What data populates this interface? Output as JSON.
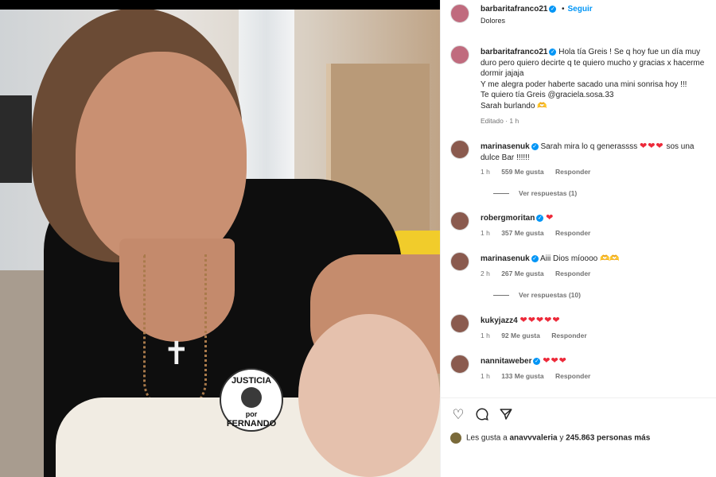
{
  "post_owner": {
    "username": "barbaritafranco21",
    "follow_label": "Seguir",
    "location": "Dolores"
  },
  "photo": {
    "badge_line1": "JUSTICIA",
    "badge_line2": "por",
    "badge_line3": "FERNANDO"
  },
  "caption": {
    "username": "barbaritafranco21",
    "lines": [
      "Hola tía Greis ! Se q hoy fue un día muy",
      "duro pero quiero decirte q te quiero mucho y gracias x hacerme",
      "dormir jajaja",
      "Y me alegra poder haberte sacado una mini sonrisa hoy !!!",
      "Te quiero tía Greis @graciela.sosa.33",
      "Sarah burlando 🫶"
    ],
    "meta": "Editado · 1 h"
  },
  "comments": [
    {
      "username": "marinasenuk",
      "text_a": "Sarah mira lo q generassss",
      "hearts": "❤❤❤",
      "text_b": "sos una",
      "text_line2": "dulce Bar !!!!!!",
      "time": "1 h",
      "likes": "559 Me gusta",
      "reply": "Responder",
      "view_replies": "Ver respuestas (1)"
    },
    {
      "username": "robergmoritan",
      "hearts": "❤",
      "time": "1 h",
      "likes": "357 Me gusta",
      "reply": "Responder"
    },
    {
      "username": "marinasenuk",
      "text_a": "Aiii Dios míoooo 🫶🫶",
      "time": "2 h",
      "likes": "267 Me gusta",
      "reply": "Responder",
      "view_replies": "Ver respuestas (10)"
    },
    {
      "username": "kukyjazz4",
      "hearts": "❤❤❤❤❤",
      "time": "1 h",
      "likes": "92 Me gusta",
      "reply": "Responder"
    },
    {
      "username": "nannitaweber",
      "hearts": "❤❤❤",
      "time": "1 h",
      "likes": "133 Me gusta",
      "reply": "Responder"
    }
  ],
  "icons": {
    "like": "heart-outline-icon",
    "comment": "comment-bubble-icon",
    "share": "paper-plane-icon",
    "save": "bookmark-icon"
  },
  "likes_summary": {
    "prefix": "Les gusta a",
    "user": "anavvvaleria",
    "suffix": "y",
    "count": "245.863 personas más"
  },
  "colors": {
    "accent": "#0095f6",
    "heart": "#ed2939",
    "muted": "#737373"
  }
}
